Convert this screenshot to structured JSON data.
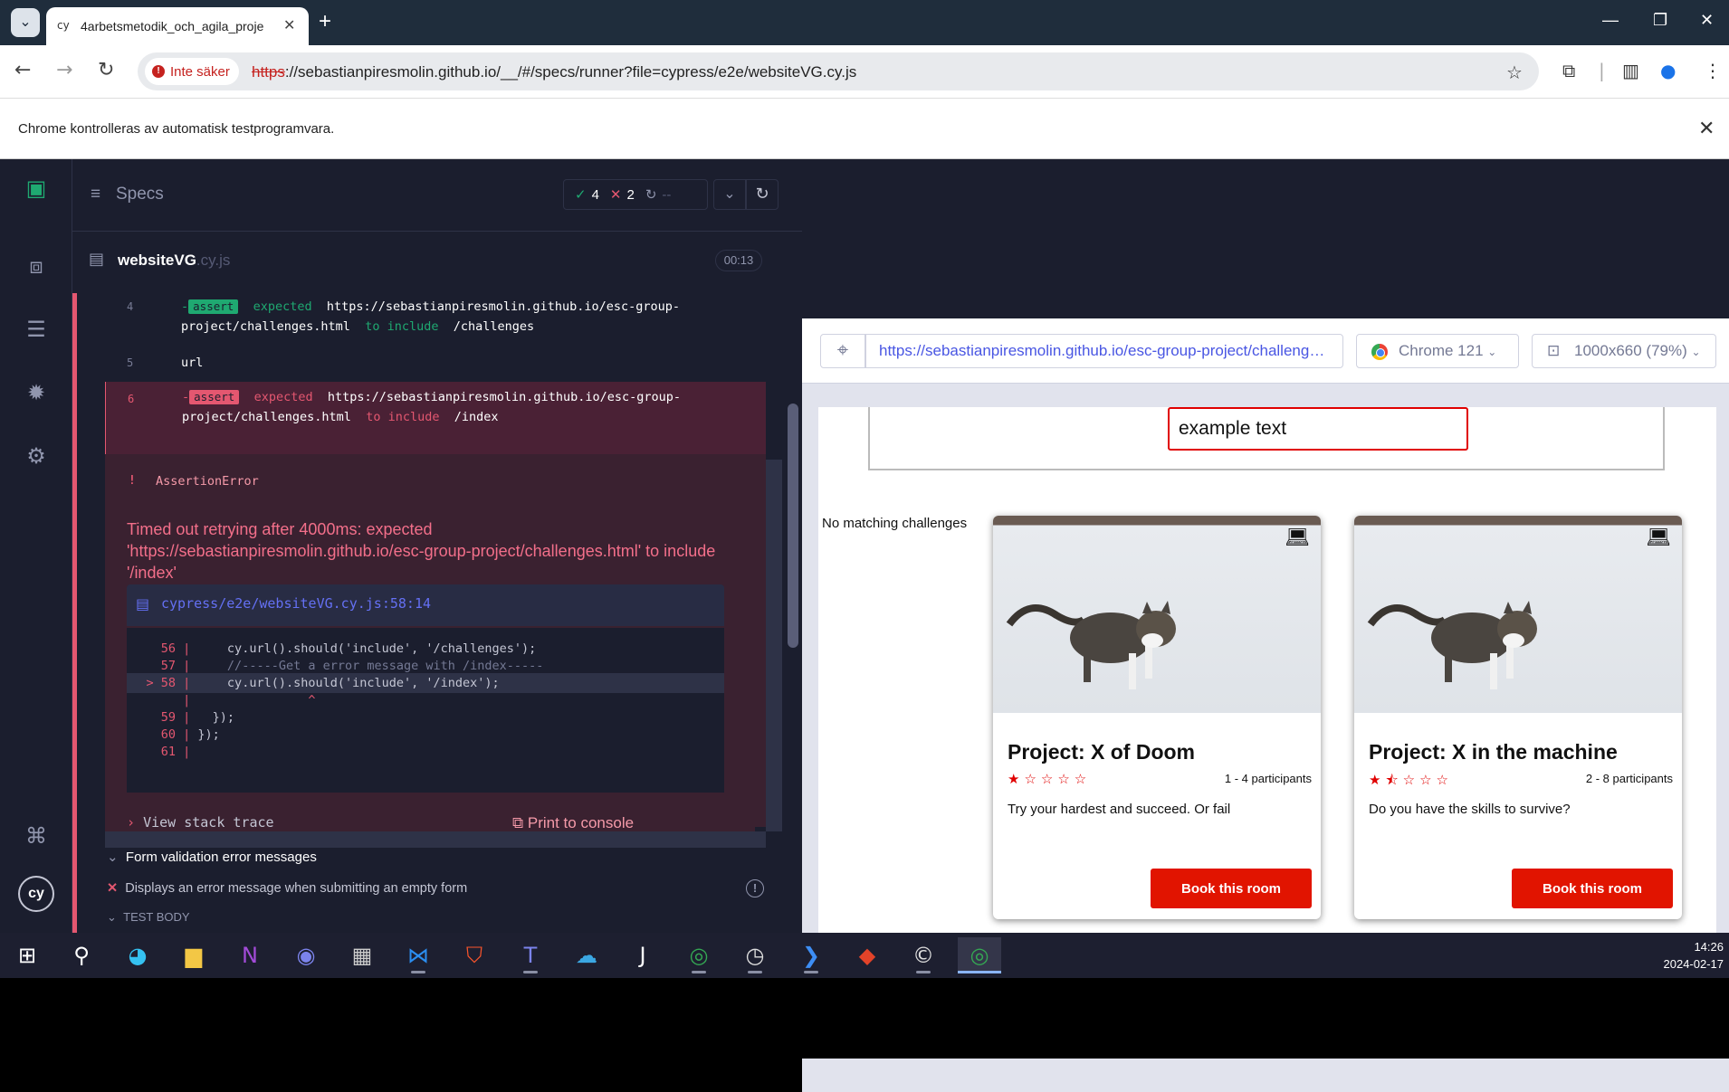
{
  "chrome": {
    "tab_title": "4arbetsmetodik_och_agila_proje",
    "new_tab_icon": "+",
    "security_chip": "Inte säker",
    "url_scheme": "https",
    "url_rest": "://sebastianpiresmolin.github.io/__/#/specs/runner?file=cypress/e2e/websiteVG.cy.js",
    "infobar_message": "Chrome kontrolleras av automatisk testprogramvara."
  },
  "reporter": {
    "specs_label": "Specs",
    "passed_count": "4",
    "failed_count": "2",
    "pending_count": "--",
    "spec_name": "websiteVG",
    "spec_ext": ".cy.js",
    "duration": "00:13",
    "commands": [
      {
        "num": "4",
        "prefix": "-",
        "tag": "assert",
        "text_a": "expected",
        "value_a": "https://sebastianpiresmolin.github.io/esc-group-",
        "value_b": "project/challenges.html",
        "text_b": "to include",
        "value_c": "/challenges"
      },
      {
        "num": "5",
        "name": "url"
      },
      {
        "num": "6",
        "prefix": "-",
        "tag": "assert",
        "text_a": "expected",
        "value_a": "https://sebastianpiresmolin.github.io/esc-group-",
        "value_b": "project/challenges.html",
        "text_b": "to include",
        "value_c": "/index"
      }
    ],
    "error": {
      "marker": "!",
      "title": "AssertionError",
      "message": "Timed out retrying after 4000ms: expected 'https://sebastianpiresmolin.github.io/esc-group-project/challenges.html' to include '/index'",
      "file": "cypress/e2e/websiteVG.cy.js:58:14",
      "code_lines": [
        {
          "n": "56",
          "code": "    cy.url().should('include', '/challenges');"
        },
        {
          "n": "57",
          "code": "    //-----Get a error message with /index-----"
        },
        {
          "n": "58",
          "code": "    cy.url().should('include', '/index');",
          "highlight": true
        },
        {
          "n": "",
          "code": "               ^"
        },
        {
          "n": "59",
          "code": "  });"
        },
        {
          "n": "60",
          "code": "});"
        },
        {
          "n": "61",
          "code": ""
        }
      ],
      "view_stack": "View stack trace",
      "print_console": "Print to console"
    },
    "suite_title": "Form validation error messages",
    "test_title": "Displays an error message when submitting an empty form",
    "test_body": "TEST BODY"
  },
  "aut": {
    "url": "https://sebastianpiresmolin.github.io/esc-group-project/challenges.html",
    "browser": "Chrome 121",
    "viewport": "1000x660",
    "scale": "(79%)",
    "filter_text": "example text",
    "no_match": "No matching challenges",
    "cards": [
      {
        "title": "Project: X of Doom",
        "stars": "★☆☆☆☆",
        "participants": "1 - 4 participants",
        "description": "Try your hardest and succeed. Or fail",
        "button": "Book this room",
        "device_icon": "laptop-icon"
      },
      {
        "title": "Project: X in the machine",
        "stars": "★⯪☆☆☆",
        "participants": "2 - 8 participants",
        "description": "Do you have the skills to survive?",
        "button": "Book this room",
        "device_icon": "laptop-icon"
      }
    ],
    "lower_cards": [
      {
        "device_icon": "house-icon"
      },
      {
        "device_icon": "laptop-icon"
      }
    ]
  },
  "taskbar": {
    "time": "14:26",
    "date": "2024-02-17"
  },
  "colors": {
    "brand_red": "#e11400",
    "cypress_fail": "#e45770",
    "cypress_pass": "#1fa971",
    "cypress_indigo": "#6470f3"
  }
}
